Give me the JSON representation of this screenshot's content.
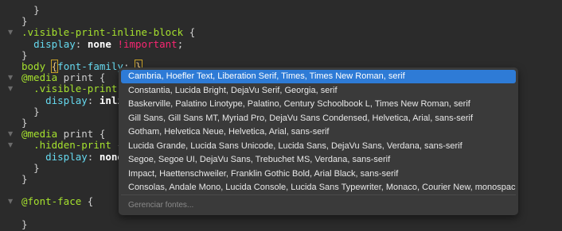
{
  "editor": {
    "lines": [
      {
        "indent": "  ",
        "parts": [
          {
            "t": "}",
            "c": "brace"
          }
        ]
      },
      {
        "indent": "",
        "parts": [
          {
            "t": "}",
            "c": "brace"
          }
        ]
      },
      {
        "indent": "",
        "fold": true,
        "parts": [
          {
            "t": ".visible-print-inline-block",
            "c": "sel"
          },
          {
            "t": " {",
            "c": "punct"
          }
        ]
      },
      {
        "indent": "  ",
        "parts": [
          {
            "t": "display",
            "c": "prop"
          },
          {
            "t": ": ",
            "c": "punct"
          },
          {
            "t": "none",
            "c": "val"
          },
          {
            "t": " !important",
            "c": "imp"
          },
          {
            "t": ";",
            "c": "punct"
          }
        ]
      },
      {
        "indent": "",
        "parts": [
          {
            "t": "}",
            "c": "brace"
          }
        ]
      },
      {
        "indent": "",
        "parts": [
          {
            "t": "body",
            "c": "sel"
          },
          {
            "t": " ",
            "c": "punct"
          },
          {
            "t": "{",
            "c": "cursorbox"
          },
          {
            "t": "font-family",
            "c": "prop"
          },
          {
            "t": ": ",
            "c": "punct"
          },
          {
            "t": "}",
            "c": "cursorbox"
          }
        ]
      },
      {
        "indent": "",
        "fold": true,
        "parts": [
          {
            "t": "@media",
            "c": "at"
          },
          {
            "t": " print {",
            "c": "punct"
          }
        ]
      },
      {
        "indent": "  ",
        "fold": true,
        "parts": [
          {
            "t": ".visible-print-i",
            "c": "sel"
          }
        ]
      },
      {
        "indent": "    ",
        "parts": [
          {
            "t": "display",
            "c": "prop"
          },
          {
            "t": ": ",
            "c": "punct"
          },
          {
            "t": "inlin",
            "c": "val"
          }
        ]
      },
      {
        "indent": "  ",
        "parts": [
          {
            "t": "}",
            "c": "brace"
          }
        ]
      },
      {
        "indent": "",
        "parts": [
          {
            "t": "}",
            "c": "brace"
          }
        ]
      },
      {
        "indent": "",
        "fold": true,
        "parts": [
          {
            "t": "@media",
            "c": "at"
          },
          {
            "t": " print {",
            "c": "punct"
          }
        ]
      },
      {
        "indent": "  ",
        "fold": true,
        "parts": [
          {
            "t": ".hidden-print",
            "c": "sel"
          },
          {
            "t": " {",
            "c": "punct"
          }
        ]
      },
      {
        "indent": "    ",
        "parts": [
          {
            "t": "display",
            "c": "prop"
          },
          {
            "t": ": ",
            "c": "punct"
          },
          {
            "t": "none",
            "c": "val"
          }
        ]
      },
      {
        "indent": "  ",
        "parts": [
          {
            "t": "}",
            "c": "brace"
          }
        ]
      },
      {
        "indent": "",
        "parts": [
          {
            "t": "}",
            "c": "brace"
          }
        ]
      },
      {
        "indent": "",
        "parts": []
      },
      {
        "indent": "",
        "fold": true,
        "parts": [
          {
            "t": "@font-face",
            "c": "at"
          },
          {
            "t": " {",
            "c": "punct"
          }
        ]
      },
      {
        "indent": "",
        "parts": []
      },
      {
        "indent": "",
        "parts": [
          {
            "t": "}",
            "c": "brace"
          }
        ]
      }
    ]
  },
  "autocomplete": {
    "items": [
      "Cambria, Hoefler Text, Liberation Serif, Times, Times New Roman, serif",
      "Constantia, Lucida Bright, DejaVu Serif, Georgia, serif",
      "Baskerville, Palatino Linotype, Palatino, Century Schoolbook L, Times New Roman, serif",
      "Gill Sans, Gill Sans MT, Myriad Pro, DejaVu Sans Condensed, Helvetica, Arial, sans-serif",
      "Gotham, Helvetica Neue, Helvetica, Arial, sans-serif",
      "Lucida Grande, Lucida Sans Unicode, Lucida Sans, DejaVu Sans, Verdana, sans-serif",
      "Segoe, Segoe UI, DejaVu Sans, Trebuchet MS, Verdana, sans-serif",
      "Impact, Haettenschweiler, Franklin Gothic Bold, Arial Black, sans-serif",
      "Consolas, Andale Mono, Lucida Console, Lucida Sans Typewriter, Monaco, Courier New, monospace"
    ],
    "selected_index": 0,
    "footer": "Gerenciar fontes..."
  },
  "colors": {
    "background": "#2b2b2b",
    "selector": "#a6e22e",
    "property": "#66d9ef",
    "important": "#f92672",
    "selection": "#2e7bd6"
  }
}
